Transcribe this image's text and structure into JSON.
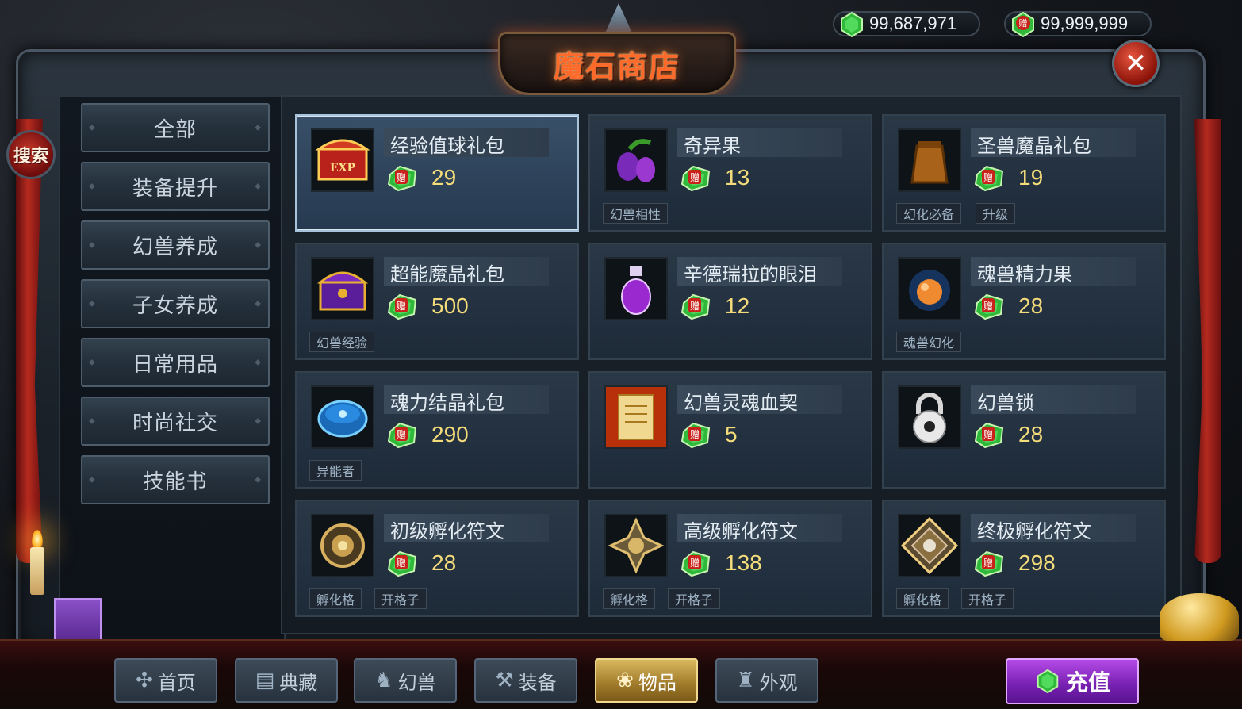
{
  "title": "魔石商店",
  "currency": {
    "primary": "99,687,971",
    "bonus": "99,999,999"
  },
  "search_label": "搜索",
  "close_label": "✕",
  "bonus_badge": "赠",
  "nav": {
    "items": [
      {
        "label": "全部",
        "active": true
      },
      {
        "label": "装备提升",
        "active": false
      },
      {
        "label": "幻兽养成",
        "active": false
      },
      {
        "label": "子女养成",
        "active": false
      },
      {
        "label": "日常用品",
        "active": false
      },
      {
        "label": "时尚社交",
        "active": false
      },
      {
        "label": "技能书",
        "active": false
      }
    ]
  },
  "items": [
    {
      "name": "经验值球礼包",
      "price": "29",
      "tags": [],
      "icon": "exp-chest-icon",
      "selected": true
    },
    {
      "name": "奇异果",
      "price": "13",
      "tags": [
        "幻兽相性"
      ],
      "icon": "purple-fruit-icon"
    },
    {
      "name": "圣兽魔晶礼包",
      "price": "19",
      "tags": [
        "幻化必备",
        "升级"
      ],
      "icon": "pouch-icon"
    },
    {
      "name": "超能魔晶礼包",
      "price": "500",
      "tags": [
        "幻兽经验"
      ],
      "icon": "purple-chest-icon"
    },
    {
      "name": "辛德瑞拉的眼泪",
      "price": "12",
      "tags": [],
      "icon": "potion-icon"
    },
    {
      "name": "魂兽精力果",
      "price": "28",
      "tags": [
        "魂兽幻化"
      ],
      "icon": "orange-fruit-icon"
    },
    {
      "name": "魂力结晶礼包",
      "price": "290",
      "tags": [
        "异能者"
      ],
      "icon": "blue-box-icon"
    },
    {
      "name": "幻兽灵魂血契",
      "price": "5",
      "tags": [],
      "icon": "scroll-icon"
    },
    {
      "name": "幻兽锁",
      "price": "28",
      "tags": [],
      "icon": "padlock-icon"
    },
    {
      "name": "初级孵化符文",
      "price": "28",
      "tags": [
        "孵化格",
        "开格子"
      ],
      "icon": "rune-basic-icon"
    },
    {
      "name": "高级孵化符文",
      "price": "138",
      "tags": [
        "孵化格",
        "开格子"
      ],
      "icon": "rune-advanced-icon"
    },
    {
      "name": "终极孵化符文",
      "price": "298",
      "tags": [
        "孵化格",
        "开格子"
      ],
      "icon": "rune-ultimate-icon"
    }
  ],
  "tabs": [
    {
      "label": "首页",
      "icon": "pinwheel-icon",
      "active": false
    },
    {
      "label": "典藏",
      "icon": "book-icon",
      "active": false
    },
    {
      "label": "幻兽",
      "icon": "dragon-icon",
      "active": false
    },
    {
      "label": "装备",
      "icon": "axe-icon",
      "active": false
    },
    {
      "label": "物品",
      "icon": "tulip-icon",
      "active": true
    },
    {
      "label": "外观",
      "icon": "shirt-icon",
      "active": false
    }
  ],
  "recharge_label": "充值",
  "colors": {
    "price": "#f5dc7a",
    "gem_green": "#3fd24a",
    "title": "#ff6a2a",
    "active_gold": "#a98640",
    "recharge_purple": "#7620b0"
  }
}
